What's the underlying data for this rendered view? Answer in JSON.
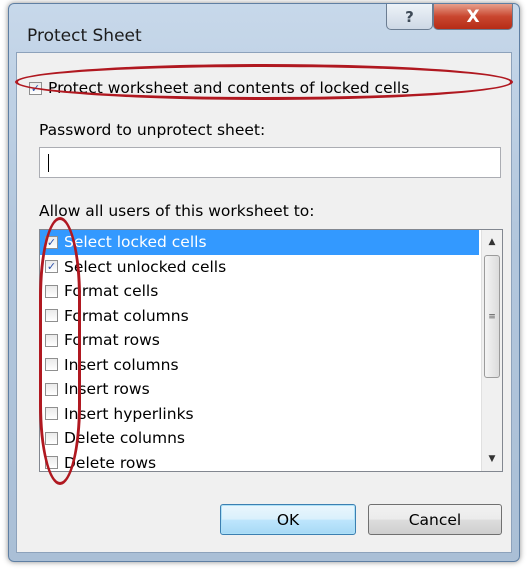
{
  "window": {
    "title": "Protect Sheet",
    "help_glyph": "?",
    "close_glyph": "X"
  },
  "protect_checkbox": {
    "label": "Protect worksheet and contents of locked cells",
    "checked": true
  },
  "password": {
    "label": "Password to unprotect sheet:",
    "value": ""
  },
  "permissions": {
    "label": "Allow all users of this worksheet to:",
    "items": [
      {
        "label": "Select locked cells",
        "checked": true,
        "selected": true
      },
      {
        "label": "Select unlocked cells",
        "checked": true,
        "selected": false
      },
      {
        "label": "Format cells",
        "checked": false,
        "selected": false
      },
      {
        "label": "Format columns",
        "checked": false,
        "selected": false
      },
      {
        "label": "Format rows",
        "checked": false,
        "selected": false
      },
      {
        "label": "Insert columns",
        "checked": false,
        "selected": false
      },
      {
        "label": "Insert rows",
        "checked": false,
        "selected": false
      },
      {
        "label": "Insert hyperlinks",
        "checked": false,
        "selected": false
      },
      {
        "label": "Delete columns",
        "checked": false,
        "selected": false
      },
      {
        "label": "Delete rows",
        "checked": false,
        "selected": false
      }
    ]
  },
  "buttons": {
    "ok": "OK",
    "cancel": "Cancel"
  },
  "colors": {
    "selection": "#3399ff",
    "annotation": "#b01820",
    "check": "#2a4fa8"
  }
}
